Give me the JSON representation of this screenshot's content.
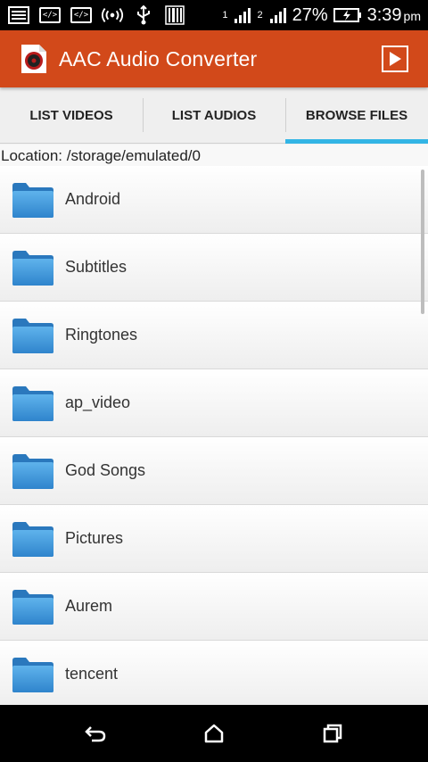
{
  "status_bar": {
    "battery_percent": "27%",
    "time": "3:39",
    "ampm": "pm",
    "sim1": "1",
    "sim2": "2",
    "code_icon_text": "</>"
  },
  "toolbar": {
    "title": "AAC Audio Converter"
  },
  "tabs": [
    {
      "label": "LIST VIDEOS",
      "active": false
    },
    {
      "label": "LIST AUDIOS",
      "active": false
    },
    {
      "label": "BROWSE FILES",
      "active": true
    }
  ],
  "location": "Location: /storage/emulated/0",
  "files": [
    {
      "name": "Android"
    },
    {
      "name": "Subtitles"
    },
    {
      "name": "Ringtones"
    },
    {
      "name": "ap_video"
    },
    {
      "name": "God Songs"
    },
    {
      "name": "Pictures"
    },
    {
      "name": "Aurem"
    },
    {
      "name": "tencent"
    }
  ],
  "colors": {
    "toolbar": "#d2491a",
    "tab_indicator": "#33b5e5",
    "folder": "#3c93d8"
  }
}
